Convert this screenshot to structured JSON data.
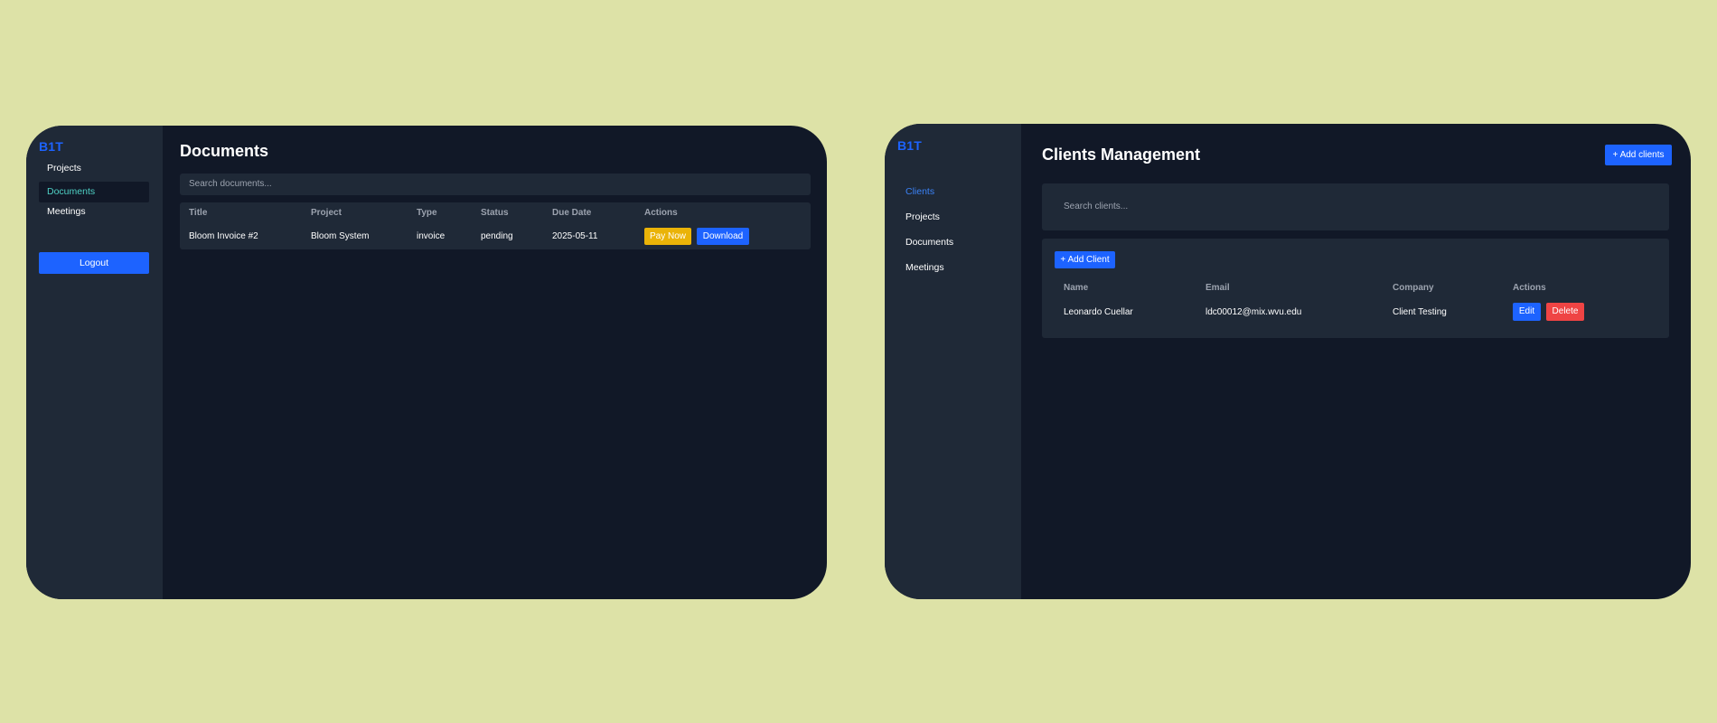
{
  "left_panel": {
    "logo": "B1T",
    "nav": [
      "Projects",
      "Documents",
      "Meetings"
    ],
    "logout_label": "Logout",
    "title": "Documents",
    "search_placeholder": "Search documents...",
    "table": {
      "headers": [
        "Title",
        "Project",
        "Type",
        "Status",
        "Due Date",
        "Actions"
      ],
      "rows": [
        {
          "title": "Bloom Invoice #2",
          "project": "Bloom System",
          "type": "invoice",
          "status": "pending",
          "due_date": "2025-05-11",
          "actions": [
            "Pay Now",
            "Download"
          ]
        }
      ]
    }
  },
  "right_panel": {
    "logo": "B1T",
    "nav": [
      "Clients",
      "Projects",
      "Documents",
      "Meetings"
    ],
    "title": "Clients Management",
    "add_top_label": "+ Add clients",
    "search_placeholder": "Search clients...",
    "add_inner_label": "+ Add Client",
    "table": {
      "headers": [
        "Name",
        "Email",
        "Company",
        "Actions"
      ],
      "rows": [
        {
          "name": "Leonardo Cuellar",
          "email": "ldc00012@mix.wvu.edu",
          "company": "Client Testing",
          "actions": [
            "Edit",
            "Delete"
          ]
        }
      ]
    }
  },
  "colors": {
    "background": "#dde2a7",
    "panel": "#111827",
    "sidebar": "#1f2937",
    "accent_blue": "#1d63ff",
    "active_teal": "#4fd1c5",
    "warning_yellow": "#eab308",
    "danger_red": "#ef4444"
  }
}
